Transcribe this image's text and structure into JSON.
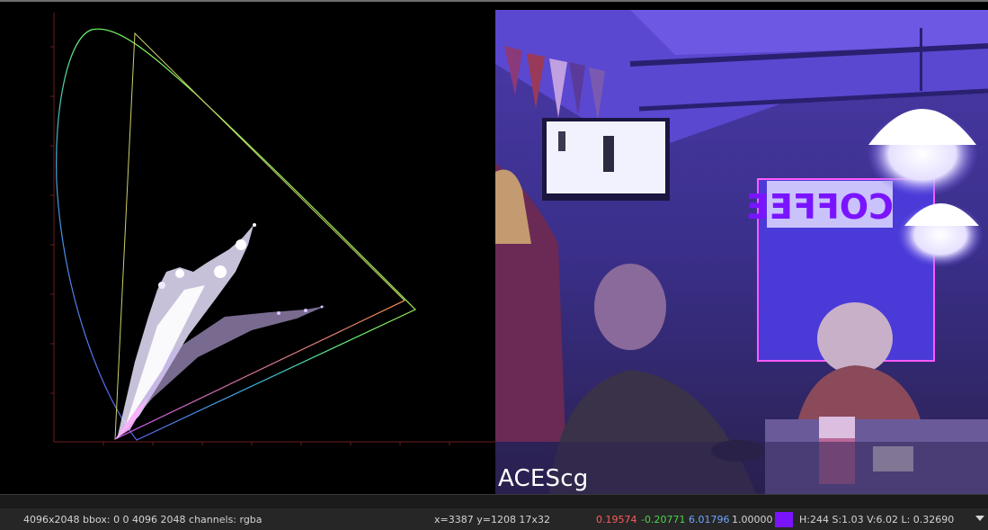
{
  "viewer": {
    "caption": "ACEScg",
    "chart_overlay": "CIE xy chromaticity diagram",
    "colors": {
      "locus_green": "#7cff6a",
      "locus_blue": "#3a6cff",
      "locus_red": "#ff7a3a",
      "gamut_line": "#cfd06a",
      "axis": "#6b1b1b"
    }
  },
  "info_bar": {
    "image_info": "4096x2048  bbox: 0 0 4096 2048 channels: rgba",
    "coords": "x=3387 y=1208 17x32",
    "r": "0.19574",
    "g": "-0.20771",
    "b": "6.01796",
    "a": "1.00000",
    "swatch_color": "#7a14ff",
    "hsv": "H:244 S:1.03 V:6.02  L: 0.32690",
    "menu_icon": "chevron-down-icon"
  }
}
